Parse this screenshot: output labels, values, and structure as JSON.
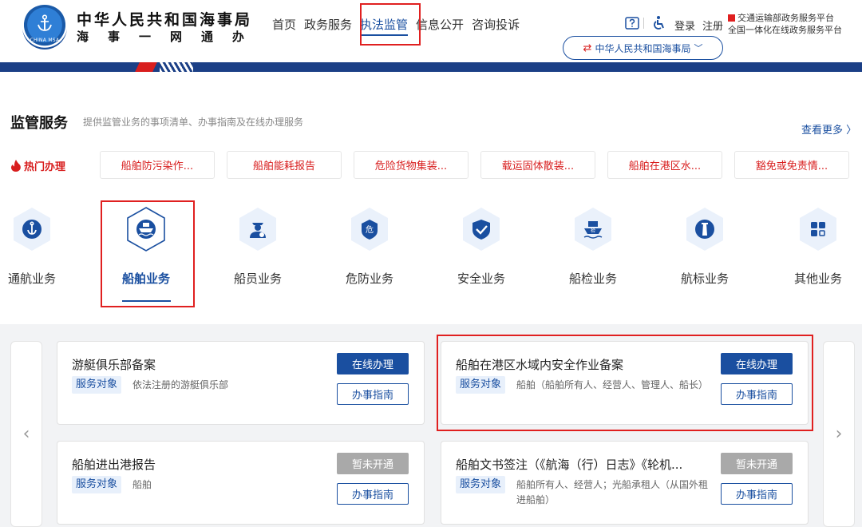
{
  "header": {
    "emblem_text": "CHINA MSA",
    "org_title": "中华人民共和国海事局",
    "org_sub": [
      "海",
      "事",
      "一",
      "网",
      "通",
      "办"
    ],
    "nav": [
      "首页",
      "政务服务",
      "执法监管",
      "信息公开",
      "咨询投诉"
    ],
    "active_nav": "执法监管",
    "login": "登录",
    "register": "注册",
    "platform_line1": "交通运输部政务服务平台",
    "platform_line2": "全国一体化在线政务服务平台",
    "org_switch": "中华人民共和国海事局"
  },
  "section": {
    "title": "监管服务",
    "desc": "提供监管业务的事项清单、办事指南及在线办理服务",
    "view_more": "查看更多 〉"
  },
  "hot": {
    "label": "热门办理",
    "items": [
      "船舶防污染作...",
      "船舶能耗报告",
      "危险货物集装...",
      "载运固体散装...",
      "船舶在港区水...",
      "豁免或免责情..."
    ]
  },
  "categories": [
    {
      "label": "通航业务",
      "icon": "anchor-icon"
    },
    {
      "label": "船舶业务",
      "icon": "ship-icon"
    },
    {
      "label": "船员业务",
      "icon": "crew-icon"
    },
    {
      "label": "危防业务",
      "icon": "hazard-icon"
    },
    {
      "label": "安全业务",
      "icon": "shield-check-icon"
    },
    {
      "label": "船检业务",
      "icon": "ship-inspection-icon"
    },
    {
      "label": "航标业务",
      "icon": "lighthouse-icon"
    },
    {
      "label": "其他业务",
      "icon": "grid-icon"
    }
  ],
  "active_category": "船舶业务",
  "cards": [
    {
      "title": "游艇俱乐部备案",
      "tag": "服务对象",
      "target": "依法注册的游艇俱乐部",
      "primary": "在线办理",
      "primary_enabled": true,
      "guide": "办事指南"
    },
    {
      "title": "船舶在港区水域内安全作业备案",
      "tag": "服务对象",
      "target": "船舶（船舶所有人、经营人、管理人、船长）",
      "primary": "在线办理",
      "primary_enabled": true,
      "guide": "办事指南"
    },
    {
      "title": "船舶进出港报告",
      "tag": "服务对象",
      "target": "船舶",
      "primary": "暂未开通",
      "primary_enabled": false,
      "guide": "办事指南"
    },
    {
      "title": "船舶文书签注（《航海（行）日志》《轮机...",
      "tag": "服务对象",
      "target": "船舶所有人、经营人；光船承租人（从国外租进船舶）",
      "primary": "暂未开通",
      "primary_enabled": false,
      "guide": "办事指南"
    }
  ],
  "colors": {
    "brand": "#1a4fa0",
    "accent_red": "#d81e1e",
    "highlight": "#e02020"
  }
}
